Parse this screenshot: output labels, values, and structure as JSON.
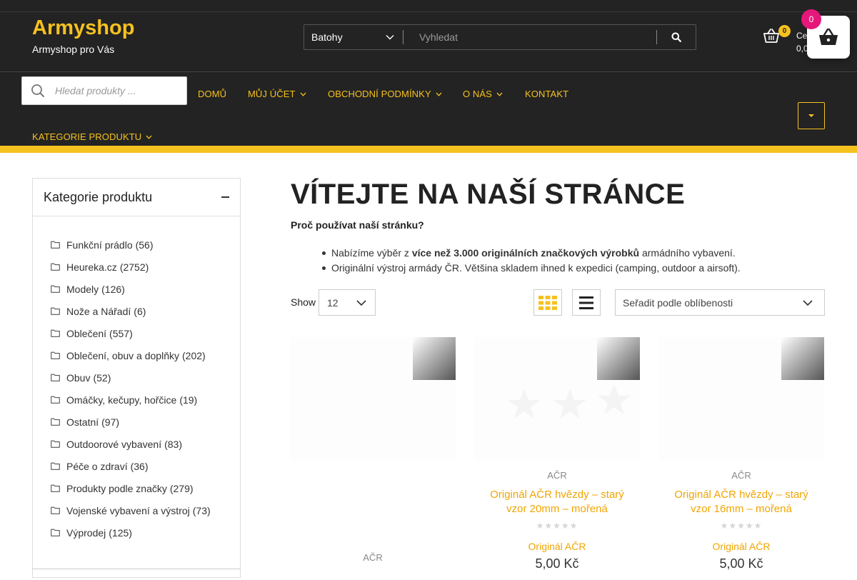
{
  "header": {
    "site_title": "Armyshop",
    "tagline": "Armyshop pro Vás",
    "search": {
      "category": "Batohy",
      "placeholder": "Vyhledat"
    },
    "cart": {
      "count": "0",
      "label": "Ce",
      "amount": "0,0"
    },
    "floating_cart_count": "0"
  },
  "product_search": {
    "placeholder": "Hledat produkty ..."
  },
  "nav": {
    "items": [
      {
        "label": "DOMŮ"
      },
      {
        "label": "MŮJ ÚČET"
      },
      {
        "label": "OBCHODNÍ PODMÍNKY"
      },
      {
        "label": "O NÁS"
      },
      {
        "label": "KONTAKT"
      }
    ],
    "categories_label": "KATEGORIE PRODUKTU"
  },
  "sidebar": {
    "title": "Kategorie produktu",
    "categories": [
      {
        "name": "Funkční prádlo",
        "count": "(56)"
      },
      {
        "name": "Heureka.cz",
        "count": "(2752)"
      },
      {
        "name": "Modely",
        "count": "(126)"
      },
      {
        "name": "Nože a Nářadí",
        "count": "(6)"
      },
      {
        "name": "Oblečení",
        "count": "(557)"
      },
      {
        "name": "Oblečení, obuv a doplňky",
        "count": "(202)"
      },
      {
        "name": "Obuv",
        "count": "(52)"
      },
      {
        "name": "Omáčky, kečupy, hořčice",
        "count": "(19)"
      },
      {
        "name": "Ostatní",
        "count": "(97)"
      },
      {
        "name": "Outdoorové vybavení",
        "count": "(83)"
      },
      {
        "name": "Péče o zdraví",
        "count": "(36)"
      },
      {
        "name": "Produkty podle značky",
        "count": "(279)"
      },
      {
        "name": "Vojenské vybavení a výstroj",
        "count": "(73)"
      },
      {
        "name": "Výprodej",
        "count": "(125)"
      }
    ]
  },
  "main": {
    "title": "VÍTEJTE NA NAŠÍ STRÁNCE",
    "subtitle": "Proč používat naší stránku?",
    "bullet1": {
      "pre": "Nabízíme výběr z ",
      "bold": "více než 3.000 originálních značkových výrobků",
      "post": " armádního vybavení."
    },
    "bullet2": "Originální výstroj armády ČR. Většina skladem ihned k expedici (camping, outdoor a airsoft).",
    "show_label": "Show",
    "per_page": "12",
    "sort_value": "Seřadit podle oblíbenosti"
  },
  "products": [
    {
      "brand": "AČR",
      "title": "",
      "category": "",
      "price": ""
    },
    {
      "brand": "AČR",
      "title": "Originál AČR hvězdy – starý vzor 20mm – mořená",
      "category": "Originál AČR",
      "price": "5,00 Kč",
      "rating": 0
    },
    {
      "brand": "AČR",
      "title": "Originál AČR hvězdy – starý vzor 16mm – mořená",
      "category": "Originál AČR",
      "price": "5,00 Kč",
      "rating": 0
    }
  ],
  "colors": {
    "accent": "#f5c11f",
    "header_bg": "#232323",
    "badge": "#e6177a",
    "link": "#f0a500"
  }
}
